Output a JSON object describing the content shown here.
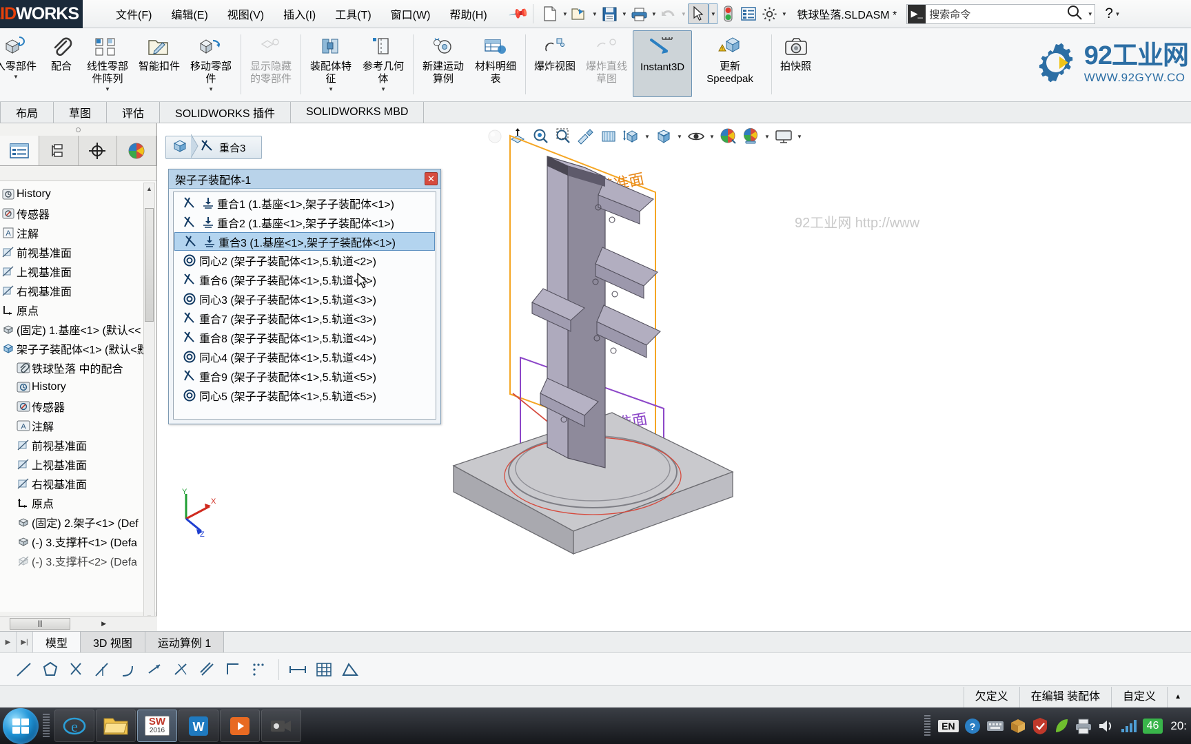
{
  "app": {
    "brand_red": "SOLID",
    "brand_white": "WORKS",
    "document_title": "铁球坠落.SLDASM *",
    "accent": "#e8410a",
    "selection_blue": "#b3d4ef"
  },
  "menubar": {
    "items": [
      {
        "label": "文件(F)",
        "name": "menu-file"
      },
      {
        "label": "编辑(E)",
        "name": "menu-edit"
      },
      {
        "label": "视图(V)",
        "name": "menu-view"
      },
      {
        "label": "插入(I)",
        "name": "menu-insert"
      },
      {
        "label": "工具(T)",
        "name": "menu-tools"
      },
      {
        "label": "窗口(W)",
        "name": "menu-window"
      },
      {
        "label": "帮助(H)",
        "name": "menu-help"
      }
    ],
    "pin_icon": "pin-icon"
  },
  "quickaccess": {
    "buttons": [
      {
        "name": "new-document-button",
        "icon": "new-file-icon",
        "caret": true
      },
      {
        "name": "open-document-button",
        "icon": "open-folder-icon",
        "caret": true
      },
      {
        "name": "save-button",
        "icon": "save-disk-icon",
        "caret": true
      },
      {
        "name": "print-button",
        "icon": "printer-icon",
        "caret": true
      },
      {
        "name": "undo-button",
        "icon": "undo-arrow-icon",
        "caret": true,
        "disabled": true
      },
      {
        "name": "select-button",
        "icon": "cursor-arrow-icon",
        "caret": true,
        "selected": true
      },
      {
        "name": "rebuild-button",
        "icon": "traffic-light-icon",
        "caret": false
      },
      {
        "name": "display-options-button",
        "icon": "list-panel-icon",
        "caret": false
      },
      {
        "name": "options-button",
        "icon": "gear-icon",
        "caret": true
      }
    ]
  },
  "search": {
    "placeholder": "搜索命令",
    "icon": "search-command-icon",
    "mag_icon": "magnifier-icon",
    "help_label": "?"
  },
  "ribbon": {
    "groups": [
      {
        "buttons": [
          {
            "label": "入零\n部件",
            "label_text": "入零部件",
            "name": "insert-components-button",
            "icon": "insert-component-icon",
            "dropdown": true,
            "disabled": false
          },
          {
            "label": "配合",
            "label_text": "配合",
            "name": "mate-button",
            "icon": "paperclip-mate-icon",
            "dropdown": false
          },
          {
            "label": "线性零部件阵列",
            "label_text": "线性零部件阵列",
            "name": "linear-component-pattern-button",
            "icon": "linear-pattern-icon",
            "dropdown": true
          },
          {
            "label": "智能扣件",
            "label_text": "智能扣件",
            "name": "smart-fasteners-button",
            "icon": "smart-fastener-icon",
            "dropdown": false
          },
          {
            "label": "移动零部件",
            "label_text": "移动零部件",
            "name": "move-component-button",
            "icon": "move-component-icon",
            "dropdown": true
          }
        ]
      },
      {
        "buttons": [
          {
            "label": "显示隐藏的零部件",
            "label_text": "显示隐藏的零部件",
            "name": "show-hidden-components-button",
            "icon": "show-hidden-icon",
            "dropdown": false,
            "disabled": true
          }
        ]
      },
      {
        "buttons": [
          {
            "label": "装配体特征",
            "label_text": "装配体特征",
            "name": "assembly-features-button",
            "icon": "assembly-feature-icon",
            "dropdown": true
          },
          {
            "label": "参考几何体",
            "label_text": "参考几何体",
            "name": "reference-geometry-button",
            "icon": "reference-geometry-icon",
            "dropdown": true
          }
        ]
      },
      {
        "buttons": [
          {
            "label": "新建运动算例",
            "label_text": "新建运动算例",
            "name": "new-motion-study-button",
            "icon": "motion-study-icon",
            "dropdown": false
          },
          {
            "label": "材料明细表",
            "label_text": "材料明细表",
            "name": "bill-of-materials-button",
            "icon": "bom-table-icon",
            "dropdown": false
          }
        ]
      },
      {
        "buttons": [
          {
            "label": "爆炸视图",
            "label_text": "爆炸视图",
            "name": "exploded-view-button",
            "icon": "exploded-view-icon",
            "dropdown": false
          },
          {
            "label": "爆炸直线草图",
            "label_text": "爆炸直线草图",
            "name": "explode-line-sketch-button",
            "icon": "explode-line-icon",
            "dropdown": false,
            "disabled": true
          },
          {
            "label": "Instant3D",
            "label_text": "Instant3D",
            "name": "instant3d-button",
            "icon": "instant3d-icon",
            "dropdown": false,
            "active": true
          },
          {
            "label": "更新\nSpeedpak",
            "label_text": "更新 Speedpak",
            "name": "update-speedpak-button",
            "icon": "update-speedpak-icon",
            "dropdown": false
          }
        ]
      },
      {
        "buttons": [
          {
            "label": "拍快照",
            "label_text": "拍快照",
            "name": "take-snapshot-button",
            "icon": "camera-icon",
            "dropdown": false
          }
        ]
      }
    ]
  },
  "ribbon_tabs": [
    {
      "label": "布局",
      "name": "tab-layout"
    },
    {
      "label": "草图",
      "name": "tab-sketch"
    },
    {
      "label": "评估",
      "name": "tab-evaluate"
    },
    {
      "label": "SOLIDWORKS 插件",
      "name": "tab-solidworks-addins"
    },
    {
      "label": "SOLIDWORKS MBD",
      "name": "tab-solidworks-mbd"
    }
  ],
  "left_panel": {
    "tabs": [
      {
        "name": "feature-manager-tab",
        "icon": "feature-tree-icon",
        "selected": true
      },
      {
        "name": "property-manager-tab",
        "icon": "property-manager-icon",
        "selected": false
      },
      {
        "name": "configuration-manager-tab",
        "icon": "configuration-icon",
        "selected": false
      },
      {
        "name": "display-manager-tab",
        "icon": "display-manager-sphere-icon",
        "selected": false
      }
    ],
    "tree": [
      {
        "label": "History",
        "icon": "history-icon",
        "indent": 0
      },
      {
        "label": "传感器",
        "icon": "sensor-icon",
        "indent": 0
      },
      {
        "label": "注解",
        "icon": "annotations-icon",
        "indent": 0
      },
      {
        "label": "前视基准面",
        "icon": "plane-icon",
        "indent": 0
      },
      {
        "label": "上视基准面",
        "icon": "plane-icon",
        "indent": 0
      },
      {
        "label": "右视基准面",
        "icon": "plane-icon",
        "indent": 0
      },
      {
        "label": "原点",
        "icon": "origin-icon",
        "indent": 0
      },
      {
        "label": "(固定) 1.基座<1> (默认<<",
        "icon": "part-icon",
        "indent": 0
      },
      {
        "label": "架子子装配体<1> (默认<默",
        "icon": "assembly-icon",
        "indent": 0
      },
      {
        "label": "铁球坠落 中的配合",
        "icon": "mates-folder-icon",
        "indent": 1
      },
      {
        "label": "History",
        "icon": "history-icon",
        "indent": 1
      },
      {
        "label": "传感器",
        "icon": "sensor-icon",
        "indent": 1
      },
      {
        "label": "注解",
        "icon": "annotations-icon",
        "indent": 1
      },
      {
        "label": "前视基准面",
        "icon": "plane-icon",
        "indent": 1
      },
      {
        "label": "上视基准面",
        "icon": "plane-icon",
        "indent": 1
      },
      {
        "label": "右视基准面",
        "icon": "plane-icon",
        "indent": 1
      },
      {
        "label": "原点",
        "icon": "origin-icon",
        "indent": 1
      },
      {
        "label": "(固定) 2.架子<1> (Def",
        "icon": "part-icon",
        "indent": 1
      },
      {
        "label": "(-) 3.支撑杆<1> (Defa",
        "icon": "part-icon",
        "indent": 1
      },
      {
        "label": "(-) 3.支撑杆<2> (Defa",
        "icon": "part-icon",
        "indent": 1
      }
    ]
  },
  "viewbar": {
    "buttons": [
      {
        "name": "previous-view-button",
        "icon": "sphere-icon",
        "disabled": true,
        "caret": false
      },
      {
        "name": "section-view-button",
        "icon": "section-view-icon",
        "disabled": false,
        "caret": false
      },
      {
        "name": "zoom-to-fit-button",
        "icon": "zoom-fit-icon",
        "disabled": false,
        "caret": false
      },
      {
        "name": "zoom-to-area-button",
        "icon": "zoom-area-icon",
        "disabled": false,
        "caret": false
      },
      {
        "name": "view-orientation-paint-button",
        "icon": "paint-brush-icon",
        "disabled": false,
        "caret": false
      },
      {
        "name": "3d-drawing-view-button",
        "icon": "cylinder-section-icon",
        "disabled": false,
        "caret": false
      },
      {
        "name": "view-orientation-button",
        "icon": "view-orientation-cube-icon",
        "disabled": false,
        "caret": true
      },
      {
        "name": "display-style-button",
        "icon": "display-style-cube-icon",
        "disabled": false,
        "caret": true
      },
      {
        "name": "hide-show-items-button",
        "icon": "eye-icon",
        "disabled": false,
        "caret": true
      },
      {
        "name": "edit-appearance-button",
        "icon": "appearance-sphere-icon",
        "disabled": false,
        "caret": false
      },
      {
        "name": "apply-scene-button",
        "icon": "scene-sphere-icon",
        "disabled": false,
        "caret": true
      },
      {
        "name": "view-settings-button",
        "icon": "monitor-icon",
        "disabled": false,
        "caret": true
      }
    ]
  },
  "graphics": {
    "watermark": "92工业网 http://www",
    "plane_label_orange": "右视基准面",
    "plane_label_purple": "右视基准面",
    "triad_axes": [
      "X",
      "Y",
      "Z"
    ]
  },
  "logo_watermark": {
    "title": "92工业网",
    "url": "WWW.92GYW.CO",
    "brand_color": "#2c6ea4",
    "accent_color": "#f0c419"
  },
  "mate_dialog": {
    "breadcrumb": {
      "assembly_icon": "assembly-cube-icon",
      "mate_icon": "coincident-mate-icon",
      "label": "重合3"
    },
    "title": "架子子装配体-1",
    "close_label": "✕",
    "rows": [
      {
        "label": "重合1 (1.基座<1>,架子子装配体<1>)",
        "icon": "coincident-mate-icon",
        "icon2": "ground-symbol-icon",
        "selected": false
      },
      {
        "label": "重合2 (1.基座<1>,架子子装配体<1>)",
        "icon": "coincident-mate-icon",
        "icon2": "ground-symbol-icon",
        "selected": false
      },
      {
        "label": "重合3 (1.基座<1>,架子子装配体<1>)",
        "icon": "coincident-mate-icon",
        "icon2": "ground-symbol-icon",
        "selected": true
      },
      {
        "label": "同心2 (架子子装配体<1>,5.轨道<2>)",
        "icon": "concentric-mate-icon",
        "icon2": "",
        "selected": false
      },
      {
        "label": "重合6 (架子子装配体<1>,5.轨道<2>)",
        "icon": "coincident-mate-icon",
        "icon2": "",
        "selected": false
      },
      {
        "label": "同心3 (架子子装配体<1>,5.轨道<3>)",
        "icon": "concentric-mate-icon",
        "icon2": "",
        "selected": false
      },
      {
        "label": "重合7 (架子子装配体<1>,5.轨道<3>)",
        "icon": "coincident-mate-icon",
        "icon2": "",
        "selected": false
      },
      {
        "label": "重合8 (架子子装配体<1>,5.轨道<4>)",
        "icon": "coincident-mate-icon",
        "icon2": "",
        "selected": false
      },
      {
        "label": "同心4 (架子子装配体<1>,5.轨道<4>)",
        "icon": "concentric-mate-icon",
        "icon2": "",
        "selected": false
      },
      {
        "label": "重合9 (架子子装配体<1>,5.轨道<5>)",
        "icon": "coincident-mate-icon",
        "icon2": "",
        "selected": false
      },
      {
        "label": "同心5 (架子子装配体<1>,5.轨道<5>)",
        "icon": "concentric-mate-icon",
        "icon2": "",
        "selected": false
      }
    ]
  },
  "bottom_tabs": [
    {
      "label": "模型",
      "name": "bottom-tab-model",
      "selected": true
    },
    {
      "label": "3D 视图",
      "name": "bottom-tab-3d-views",
      "selected": false
    },
    {
      "label": "运动算例 1",
      "name": "bottom-tab-motion-study-1",
      "selected": false
    }
  ],
  "sketch_toolbar": [
    {
      "name": "line-tool",
      "icon": "line-icon"
    },
    {
      "name": "polygon-tool",
      "icon": "polygon-icon"
    },
    {
      "name": "trim-entities-tool",
      "icon": "trim-scissors-icon"
    },
    {
      "name": "convert-entities-tool",
      "icon": "convert-entities-icon"
    },
    {
      "name": "sketch-fillet-tool",
      "icon": "sketch-fillet-icon"
    },
    {
      "name": "offset-entities-tool",
      "icon": "offset-entities-icon"
    },
    {
      "name": "mirror-entities-tool",
      "icon": "mirror-entities-icon"
    },
    {
      "name": "linear-sketch-pattern-tool",
      "icon": "linear-sketch-pattern-icon"
    },
    {
      "name": "point-tool",
      "icon": "point-dots-icon"
    },
    {
      "name": "smart-dimension-tool",
      "icon": "smart-dimension-icon"
    },
    {
      "name": "grid-settings-tool",
      "icon": "grid-icon"
    },
    {
      "name": "angle-tool",
      "icon": "angle-icon"
    }
  ],
  "statusbar": {
    "items": [
      {
        "label": "欠定义",
        "name": "status-underdefined"
      },
      {
        "label": "在编辑 装配体",
        "name": "status-editing-assembly"
      },
      {
        "label": "自定义",
        "name": "status-custom"
      }
    ],
    "expand_icon": "caret-up-icon"
  },
  "taskbar": {
    "start_icon": "windows-start-icon",
    "items": [
      {
        "name": "taskbar-internet-explorer",
        "icon": "internet-explorer-icon",
        "active": false
      },
      {
        "name": "taskbar-file-explorer",
        "icon": "folder-explorer-icon",
        "active": false
      },
      {
        "name": "taskbar-solidworks-2016",
        "icon": "solidworks-2016-icon",
        "label": "SW",
        "sub": "2016",
        "active": true
      },
      {
        "name": "taskbar-wps-office",
        "icon": "wps-office-icon",
        "label": "W",
        "active": false
      },
      {
        "name": "taskbar-media-player",
        "icon": "media-player-icon",
        "active": false
      },
      {
        "name": "taskbar-screen-recorder",
        "icon": "screen-recorder-icon",
        "active": false
      }
    ],
    "tray": {
      "language": "EN",
      "help_icon": "help-circle-icon",
      "icons": [
        "keyboard-icon",
        "box-icon",
        "shield-icon",
        "leaf-icon",
        "printer-tray-icon",
        "volume-icon",
        "network-icon"
      ],
      "badge": "46",
      "clock": "20:"
    }
  }
}
